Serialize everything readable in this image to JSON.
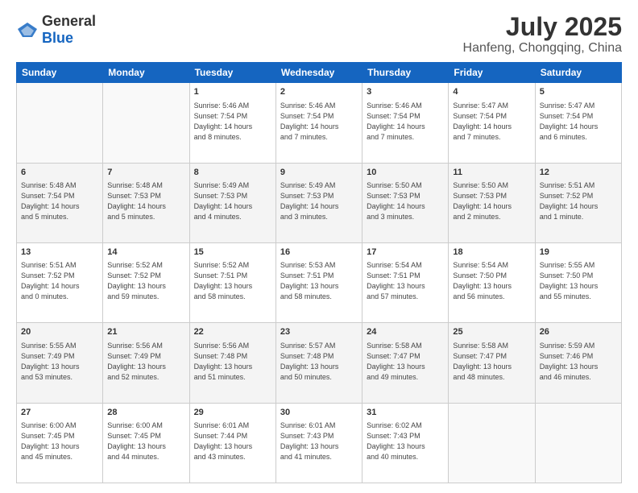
{
  "header": {
    "logo": {
      "general": "General",
      "blue": "Blue"
    },
    "month": "July 2025",
    "location": "Hanfeng, Chongqing, China"
  },
  "weekdays": [
    "Sunday",
    "Monday",
    "Tuesday",
    "Wednesday",
    "Thursday",
    "Friday",
    "Saturday"
  ],
  "weeks": [
    [
      {
        "day": "",
        "info": ""
      },
      {
        "day": "",
        "info": ""
      },
      {
        "day": "1",
        "info": "Sunrise: 5:46 AM\nSunset: 7:54 PM\nDaylight: 14 hours\nand 8 minutes."
      },
      {
        "day": "2",
        "info": "Sunrise: 5:46 AM\nSunset: 7:54 PM\nDaylight: 14 hours\nand 7 minutes."
      },
      {
        "day": "3",
        "info": "Sunrise: 5:46 AM\nSunset: 7:54 PM\nDaylight: 14 hours\nand 7 minutes."
      },
      {
        "day": "4",
        "info": "Sunrise: 5:47 AM\nSunset: 7:54 PM\nDaylight: 14 hours\nand 7 minutes."
      },
      {
        "day": "5",
        "info": "Sunrise: 5:47 AM\nSunset: 7:54 PM\nDaylight: 14 hours\nand 6 minutes."
      }
    ],
    [
      {
        "day": "6",
        "info": "Sunrise: 5:48 AM\nSunset: 7:54 PM\nDaylight: 14 hours\nand 5 minutes."
      },
      {
        "day": "7",
        "info": "Sunrise: 5:48 AM\nSunset: 7:53 PM\nDaylight: 14 hours\nand 5 minutes."
      },
      {
        "day": "8",
        "info": "Sunrise: 5:49 AM\nSunset: 7:53 PM\nDaylight: 14 hours\nand 4 minutes."
      },
      {
        "day": "9",
        "info": "Sunrise: 5:49 AM\nSunset: 7:53 PM\nDaylight: 14 hours\nand 3 minutes."
      },
      {
        "day": "10",
        "info": "Sunrise: 5:50 AM\nSunset: 7:53 PM\nDaylight: 14 hours\nand 3 minutes."
      },
      {
        "day": "11",
        "info": "Sunrise: 5:50 AM\nSunset: 7:53 PM\nDaylight: 14 hours\nand 2 minutes."
      },
      {
        "day": "12",
        "info": "Sunrise: 5:51 AM\nSunset: 7:52 PM\nDaylight: 14 hours\nand 1 minute."
      }
    ],
    [
      {
        "day": "13",
        "info": "Sunrise: 5:51 AM\nSunset: 7:52 PM\nDaylight: 14 hours\nand 0 minutes."
      },
      {
        "day": "14",
        "info": "Sunrise: 5:52 AM\nSunset: 7:52 PM\nDaylight: 13 hours\nand 59 minutes."
      },
      {
        "day": "15",
        "info": "Sunrise: 5:52 AM\nSunset: 7:51 PM\nDaylight: 13 hours\nand 58 minutes."
      },
      {
        "day": "16",
        "info": "Sunrise: 5:53 AM\nSunset: 7:51 PM\nDaylight: 13 hours\nand 58 minutes."
      },
      {
        "day": "17",
        "info": "Sunrise: 5:54 AM\nSunset: 7:51 PM\nDaylight: 13 hours\nand 57 minutes."
      },
      {
        "day": "18",
        "info": "Sunrise: 5:54 AM\nSunset: 7:50 PM\nDaylight: 13 hours\nand 56 minutes."
      },
      {
        "day": "19",
        "info": "Sunrise: 5:55 AM\nSunset: 7:50 PM\nDaylight: 13 hours\nand 55 minutes."
      }
    ],
    [
      {
        "day": "20",
        "info": "Sunrise: 5:55 AM\nSunset: 7:49 PM\nDaylight: 13 hours\nand 53 minutes."
      },
      {
        "day": "21",
        "info": "Sunrise: 5:56 AM\nSunset: 7:49 PM\nDaylight: 13 hours\nand 52 minutes."
      },
      {
        "day": "22",
        "info": "Sunrise: 5:56 AM\nSunset: 7:48 PM\nDaylight: 13 hours\nand 51 minutes."
      },
      {
        "day": "23",
        "info": "Sunrise: 5:57 AM\nSunset: 7:48 PM\nDaylight: 13 hours\nand 50 minutes."
      },
      {
        "day": "24",
        "info": "Sunrise: 5:58 AM\nSunset: 7:47 PM\nDaylight: 13 hours\nand 49 minutes."
      },
      {
        "day": "25",
        "info": "Sunrise: 5:58 AM\nSunset: 7:47 PM\nDaylight: 13 hours\nand 48 minutes."
      },
      {
        "day": "26",
        "info": "Sunrise: 5:59 AM\nSunset: 7:46 PM\nDaylight: 13 hours\nand 46 minutes."
      }
    ],
    [
      {
        "day": "27",
        "info": "Sunrise: 6:00 AM\nSunset: 7:45 PM\nDaylight: 13 hours\nand 45 minutes."
      },
      {
        "day": "28",
        "info": "Sunrise: 6:00 AM\nSunset: 7:45 PM\nDaylight: 13 hours\nand 44 minutes."
      },
      {
        "day": "29",
        "info": "Sunrise: 6:01 AM\nSunset: 7:44 PM\nDaylight: 13 hours\nand 43 minutes."
      },
      {
        "day": "30",
        "info": "Sunrise: 6:01 AM\nSunset: 7:43 PM\nDaylight: 13 hours\nand 41 minutes."
      },
      {
        "day": "31",
        "info": "Sunrise: 6:02 AM\nSunset: 7:43 PM\nDaylight: 13 hours\nand 40 minutes."
      },
      {
        "day": "",
        "info": ""
      },
      {
        "day": "",
        "info": ""
      }
    ]
  ]
}
